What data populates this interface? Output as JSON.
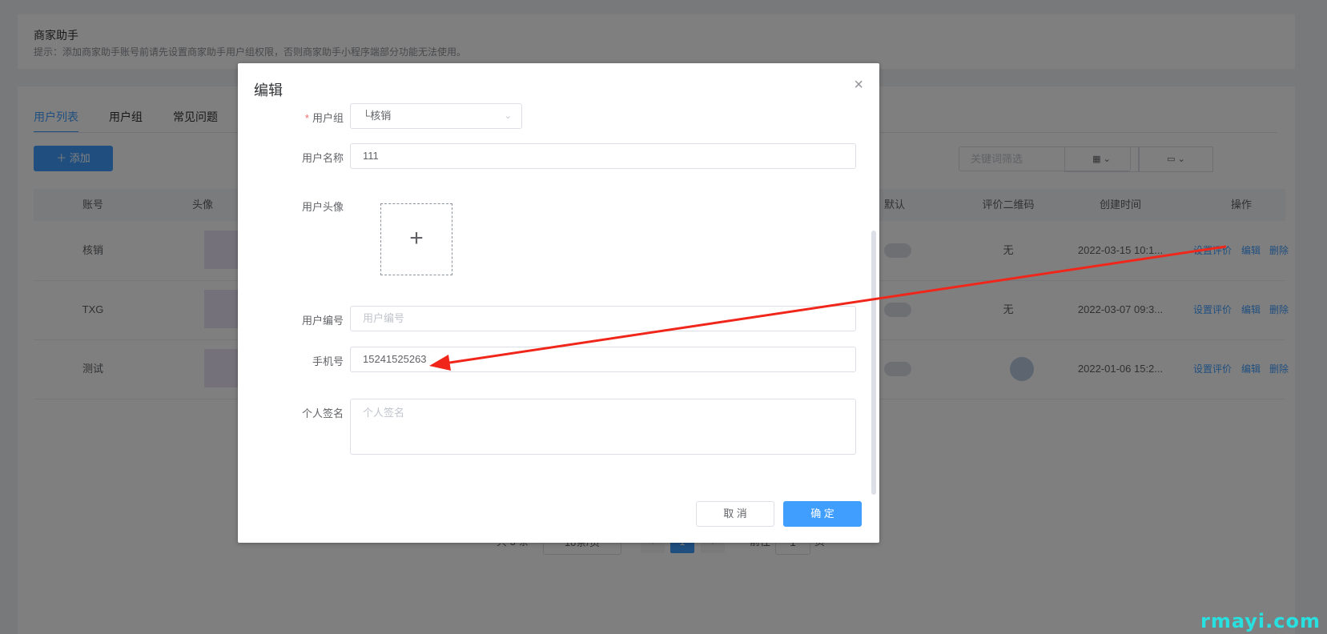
{
  "notice": {
    "title": "商家助手",
    "hint": "提示：添加商家助手账号前请先设置商家助手用户组权限，否则商家助手小程序端部分功能无法使用。"
  },
  "tabs": [
    "用户列表",
    "用户组",
    "常见问题"
  ],
  "toolbar": {
    "add_label": "＋ 添加",
    "keyword_placeholder": "关键词筛选",
    "grid_icon": "grid-icon",
    "folder_icon": "folder-icon"
  },
  "table": {
    "headers": {
      "account": "账号",
      "avatar": "头像",
      "default": "默认",
      "qrcode": "评价二维码",
      "created": "创建时间",
      "actions": "操作"
    },
    "rows": [
      {
        "account": "核销",
        "qrcode": "无",
        "created": "2022-03-15 10:1...",
        "op_eval": "设置评价",
        "op_edit": "编辑",
        "op_del": "删除"
      },
      {
        "account": "TXG",
        "qrcode": "无",
        "created": "2022-03-07 09:3...",
        "op_eval": "设置评价",
        "op_edit": "编辑",
        "op_del": "删除"
      },
      {
        "account": "测试",
        "qrcode": "",
        "created": "2022-01-06 15:2...",
        "op_eval": "设置评价",
        "op_edit": "编辑",
        "op_del": "删除"
      }
    ]
  },
  "pager": {
    "total": "共 3 条",
    "size": "10条/页",
    "prev": "‹",
    "current": "1",
    "next": "›",
    "goto_label": "前往",
    "goto_value": "1",
    "page_suffix": "页"
  },
  "dialog": {
    "title": "编辑",
    "close": "×",
    "group_label": "用户组",
    "group_value": "└核销",
    "name_label": "用户名称",
    "name_value": "111",
    "avatar_label": "用户头像",
    "upload_plus": "+",
    "number_label": "用户编号",
    "number_placeholder": "用户编号",
    "phone_label": "手机号",
    "phone_value": "15241525263",
    "sign_label": "个人签名",
    "sign_placeholder": "个人签名",
    "cancel": "取 消",
    "ok": "确 定"
  },
  "watermark": "rmayi.com"
}
